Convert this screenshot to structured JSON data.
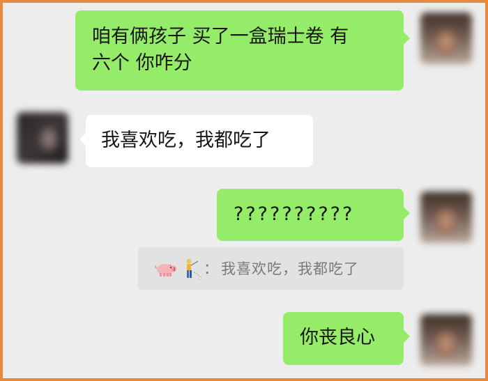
{
  "chat": {
    "messages": [
      {
        "side": "right",
        "text_line1": "咱有俩孩子 买了一盒瑞士卷 有",
        "text_line2": "六个 你咋分"
      },
      {
        "side": "left",
        "text": "我喜欢吃，我都吃了"
      },
      {
        "side": "right",
        "text": "??????????"
      },
      {
        "side": "right",
        "text": "你丧良心"
      }
    ],
    "quote": {
      "sender_icons": [
        "pig-emoji-icon",
        "golfer-emoji-icon"
      ],
      "separator": "：",
      "text": "我喜欢吃，我都吃了"
    }
  },
  "colors": {
    "frame": "#e78a3e",
    "background": "#ededed",
    "outgoing_bubble": "#95ec69",
    "incoming_bubble": "#ffffff",
    "quote_background": "#e2e2e2"
  }
}
